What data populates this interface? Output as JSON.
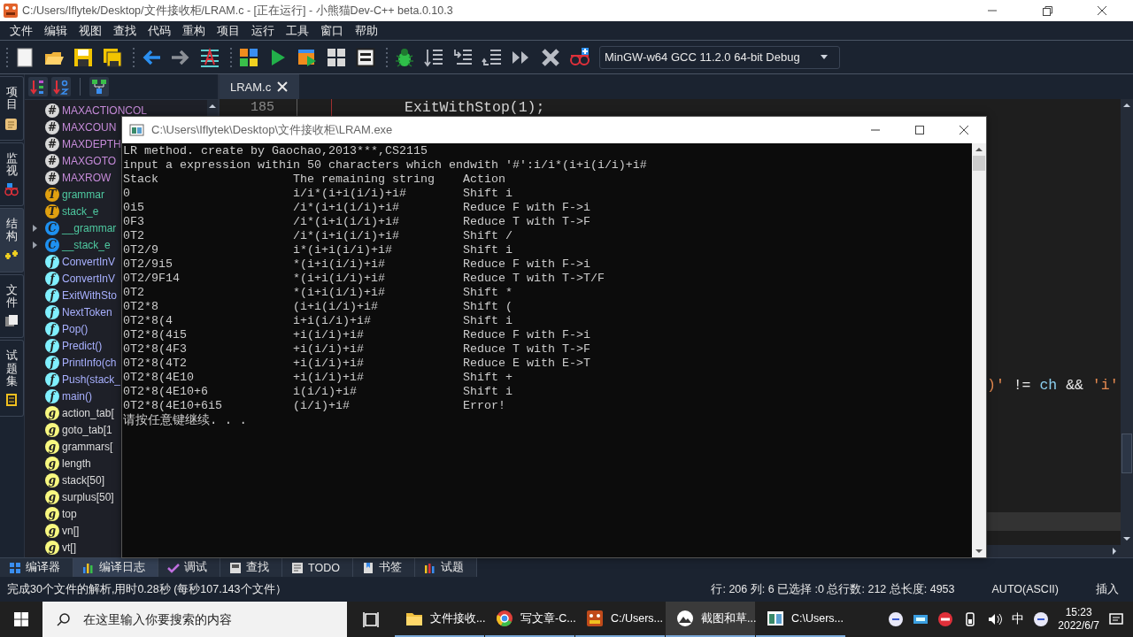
{
  "window": {
    "title": "C:/Users/Iflytek/Desktop/文件接收柜/LRAM.c - [正在运行] - 小熊猫Dev-C++ beta.0.10.3"
  },
  "menu": [
    "文件",
    "编辑",
    "视图",
    "查找",
    "代码",
    "重构",
    "项目",
    "运行",
    "工具",
    "窗口",
    "帮助"
  ],
  "toolbar": {
    "compiler": "MinGW-w64 GCC 11.2.0 64-bit Debug"
  },
  "side_tabs": [
    {
      "label": "项目",
      "selected": false
    },
    {
      "label": "监视",
      "selected": false
    },
    {
      "label": "结构",
      "selected": true
    },
    {
      "label": "文件",
      "selected": false
    },
    {
      "label": "试题集",
      "selected": false
    }
  ],
  "class_browser": {
    "items": [
      {
        "kind": "define",
        "badge": "#",
        "name": "MAXACTIONCOL"
      },
      {
        "kind": "define",
        "badge": "#",
        "name": "MAXCOUN"
      },
      {
        "kind": "define",
        "badge": "#",
        "name": "MAXDEPTH"
      },
      {
        "kind": "define",
        "badge": "#",
        "name": "MAXGOTO"
      },
      {
        "kind": "define",
        "badge": "#",
        "name": "MAXROW"
      },
      {
        "kind": "typedef",
        "badge": "T",
        "name": "grammar"
      },
      {
        "kind": "typedef",
        "badge": "T",
        "name": "stack_e"
      },
      {
        "kind": "struct",
        "badge": "C",
        "name": "__grammar",
        "expanded": false
      },
      {
        "kind": "struct",
        "badge": "C",
        "name": "__stack_e",
        "expanded": false
      },
      {
        "kind": "function",
        "badge": "f",
        "name": "ConvertInV"
      },
      {
        "kind": "function",
        "badge": "f",
        "name": "ConvertInV"
      },
      {
        "kind": "function",
        "badge": "f",
        "name": "ExitWithSto"
      },
      {
        "kind": "function",
        "badge": "f",
        "name": "NextToken"
      },
      {
        "kind": "function",
        "badge": "f",
        "name": "Pop()"
      },
      {
        "kind": "function",
        "badge": "f",
        "name": "Predict()"
      },
      {
        "kind": "function",
        "badge": "f",
        "name": "PrintInfo(ch"
      },
      {
        "kind": "function",
        "badge": "f",
        "name": "Push(stack_"
      },
      {
        "kind": "function",
        "badge": "f",
        "name": "main()"
      },
      {
        "kind": "variable",
        "badge": "g",
        "name": "action_tab["
      },
      {
        "kind": "variable",
        "badge": "g",
        "name": "goto_tab[1"
      },
      {
        "kind": "variable",
        "badge": "g",
        "name": "grammars["
      },
      {
        "kind": "variable",
        "badge": "g",
        "name": "length"
      },
      {
        "kind": "variable",
        "badge": "g",
        "name": "stack[50]"
      },
      {
        "kind": "variable",
        "badge": "g",
        "name": "surplus[50]"
      },
      {
        "kind": "variable",
        "badge": "g",
        "name": "top"
      },
      {
        "kind": "variable",
        "badge": "g",
        "name": "vn[]"
      },
      {
        "kind": "variable",
        "badge": "g",
        "name": "vt[]"
      }
    ]
  },
  "editor": {
    "tabs": [
      {
        "label": "LRAM.c",
        "selected": true
      }
    ],
    "lines": [
      {
        "number": "185",
        "segments": [
          {
            "kind": "ident",
            "text": "ExitWithStop(1);"
          }
        ]
      },
      {
        "segments": [
          {
            "kind": "string",
            "text": ")'"
          },
          {
            "kind": "op",
            "text": " != "
          },
          {
            "kind": "var",
            "text": "ch"
          },
          {
            "kind": "op",
            "text": " && "
          },
          {
            "kind": "string",
            "text": "'i'"
          }
        ]
      }
    ]
  },
  "console": {
    "title": "C:\\Users\\Iflytek\\Desktop\\文件接收柜\\LRAM.exe",
    "intro": [
      "LR method. create by Gaochao,2013***,CS2115",
      "input a expression within 50 characters which endwith '#':i/i*(i+i(i/i)+i#"
    ],
    "columns": [
      "Stack",
      "The remaining string",
      "Action"
    ],
    "rows": [
      {
        "stack": "0",
        "remaining": "i/i*(i+i(i/i)+i#",
        "action": "Shift i"
      },
      {
        "stack": "0i5",
        "remaining": "/i*(i+i(i/i)+i#",
        "action": "Reduce F with F->i"
      },
      {
        "stack": "0F3",
        "remaining": "/i*(i+i(i/i)+i#",
        "action": "Reduce T with T->F"
      },
      {
        "stack": "0T2",
        "remaining": "/i*(i+i(i/i)+i#",
        "action": "Shift /"
      },
      {
        "stack": "0T2/9",
        "remaining": "i*(i+i(i/i)+i#",
        "action": "Shift i"
      },
      {
        "stack": "0T2/9i5",
        "remaining": "*(i+i(i/i)+i#",
        "action": "Reduce F with F->i"
      },
      {
        "stack": "0T2/9F14",
        "remaining": "*(i+i(i/i)+i#",
        "action": "Reduce T with T->T/F"
      },
      {
        "stack": "0T2",
        "remaining": "*(i+i(i/i)+i#",
        "action": "Shift *"
      },
      {
        "stack": "0T2*8",
        "remaining": "(i+i(i/i)+i#",
        "action": "Shift ("
      },
      {
        "stack": "0T2*8(4",
        "remaining": "i+i(i/i)+i#",
        "action": "Shift i"
      },
      {
        "stack": "0T2*8(4i5",
        "remaining": "+i(i/i)+i#",
        "action": "Reduce F with F->i"
      },
      {
        "stack": "0T2*8(4F3",
        "remaining": "+i(i/i)+i#",
        "action": "Reduce T with T->F"
      },
      {
        "stack": "0T2*8(4T2",
        "remaining": "+i(i/i)+i#",
        "action": "Reduce E with E->T"
      },
      {
        "stack": "0T2*8(4E10",
        "remaining": "+i(i/i)+i#",
        "action": "Shift +"
      },
      {
        "stack": "0T2*8(4E10+6",
        "remaining": "i(i/i)+i#",
        "action": "Shift i"
      },
      {
        "stack": "0T2*8(4E10+6i5",
        "remaining": "(i/i)+i#",
        "action": "Error!"
      }
    ],
    "prompt": "请按任意键继续. . ."
  },
  "bottom_tabs": [
    {
      "label": "编译器",
      "selected": false
    },
    {
      "label": "编译日志",
      "selected": true
    },
    {
      "label": "调试",
      "selected": false
    },
    {
      "label": "查找",
      "selected": false
    },
    {
      "label": "TODO",
      "selected": false
    },
    {
      "label": "书签",
      "selected": false
    },
    {
      "label": "试题",
      "selected": false
    }
  ],
  "status_bar": {
    "message": "完成30个文件的解析,用时0.28秒 (每秒107.143个文件）",
    "position": "行: 206 列: 6 已选择 :0 总行数: 212 总长度: 4953",
    "encoding": "AUTO(ASCII)",
    "mode": "插入"
  },
  "taskbar": {
    "search_placeholder": "在这里输入你要搜索的内容",
    "apps": [
      {
        "kind": "folder",
        "label": "文件接收...",
        "selected": false
      },
      {
        "kind": "browser",
        "label": "写文章-C...",
        "selected": false
      },
      {
        "kind": "ide",
        "label": "C:/Users...",
        "selected": false
      },
      {
        "kind": "snip",
        "label": "截图和草...",
        "selected": true
      },
      {
        "kind": "console",
        "label": "C:\\Users...",
        "selected": false
      }
    ],
    "ime": "中",
    "time": "15:23",
    "date": "2022/6/7"
  }
}
